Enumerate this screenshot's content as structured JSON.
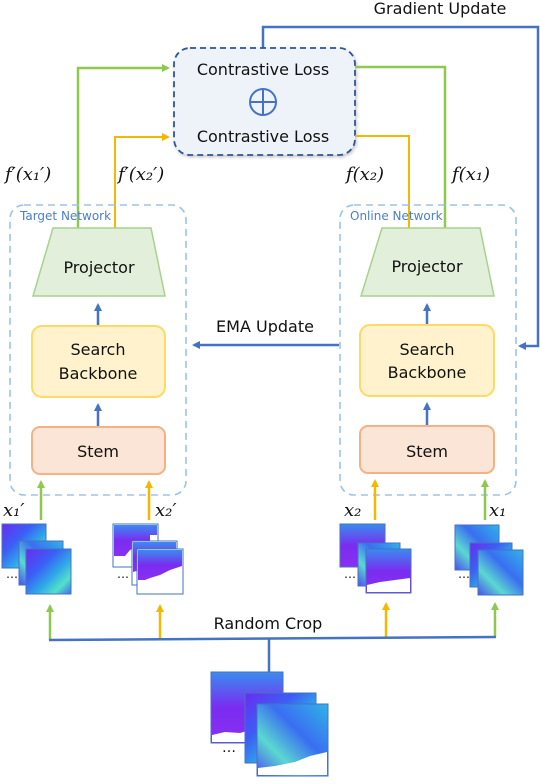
{
  "figure": {
    "gradient_update_label": "Gradient Update",
    "ema_update_label": "EMA Update",
    "random_crop_label": "Random Crop",
    "loss_box": {
      "top_label": "Contrastive Loss",
      "bottom_label": "Contrastive Loss",
      "operator_icon": "circled-plus"
    },
    "target_network": {
      "title": "Target Network",
      "projector_label": "Projector",
      "backbone_label_line1": "Search",
      "backbone_label_line2": "Backbone",
      "stem_label": "Stem",
      "output_1": "f′(x₁′)",
      "output_2": "f′(x₂′)",
      "input_1": "x₁′",
      "input_2": "x₂′"
    },
    "online_network": {
      "title": "Online Network",
      "projector_label": "Projector",
      "backbone_label_line1": "Search",
      "backbone_label_line2": "Backbone",
      "stem_label": "Stem",
      "output_1": "f(x₂)",
      "output_2": "f(x₁)",
      "input_1": "x₂",
      "input_2": "x₁"
    },
    "ellipsis": "…",
    "colors": {
      "green": "#8dc94e",
      "orange": "#f5b800",
      "blue": "#4472c4",
      "dashed_blue": "#9dc3e6",
      "loss_fill": "#eef3fa",
      "loss_border": "#2f5597",
      "projector_fill": "#e2efda",
      "projector_border": "#a9d18e",
      "backbone_fill": "#fff2cc",
      "backbone_border": "#ffd966",
      "stem_fill": "#fbe5d6",
      "stem_border": "#f4b183"
    }
  }
}
